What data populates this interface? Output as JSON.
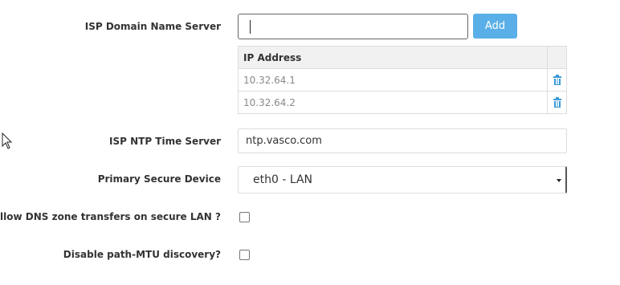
{
  "dns": {
    "label": "ISP Domain Name Server",
    "input_value": "",
    "add_label": "Add"
  },
  "ip_table": {
    "header": "IP Address",
    "rows": [
      {
        "ip": "10.32.64.1"
      },
      {
        "ip": "10.32.64.2"
      }
    ],
    "delete_icon": "trash-icon"
  },
  "ntp": {
    "label": "ISP NTP Time Server",
    "value": "ntp.vasco.com"
  },
  "device": {
    "label": "Primary Secure Device",
    "selected": "eth0 - LAN"
  },
  "dns_zone": {
    "label": "Allow DNS zone transfers on secure LAN ?",
    "checked": false
  },
  "mtu": {
    "label": "Disable path-MTU discovery?",
    "checked": false
  },
  "colors": {
    "accent": "#5aafe8",
    "icon": "#3c9ad6"
  }
}
